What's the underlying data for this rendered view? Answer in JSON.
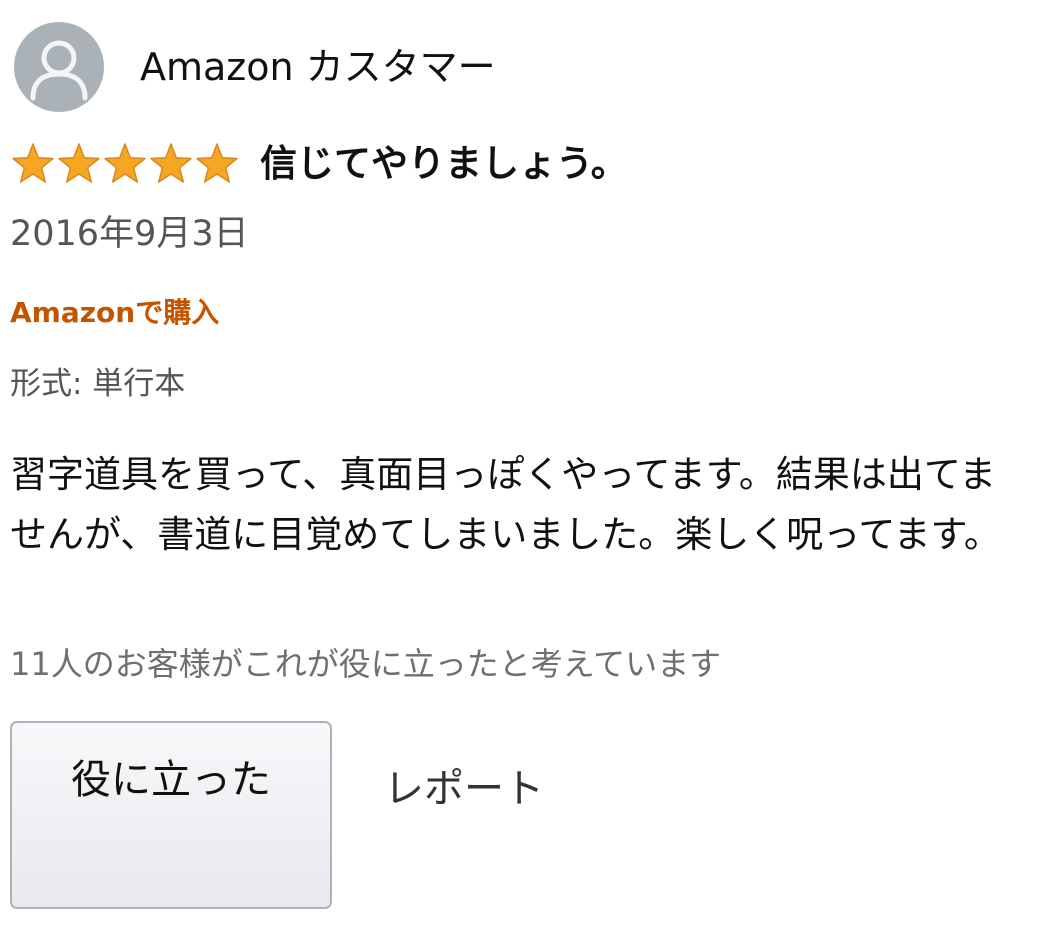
{
  "review": {
    "author": "Amazon カスタマー",
    "rating": 5,
    "rating_max": 5,
    "title": "信じてやりましょう。",
    "date": "2016年9月3日",
    "verified": "Amazonで購入",
    "format": "形式: 単行本",
    "body": "習字道具を買って、真面目っぽくやってます。結果は出てませんが、書道に目覚めてしまいました。楽しく呪ってます。",
    "helpful_count": "11人のお客様がこれが役に立ったと考えています"
  },
  "actions": {
    "helpful_label": "役に立った",
    "report_label": "レポート"
  },
  "icons": {
    "avatar": "user-avatar-icon",
    "star": "star-icon"
  },
  "colors": {
    "verified": "#c45500",
    "star_fill": "#f5a623",
    "avatar_bg": "#aab2b7",
    "button_border": "#adb1b8"
  }
}
